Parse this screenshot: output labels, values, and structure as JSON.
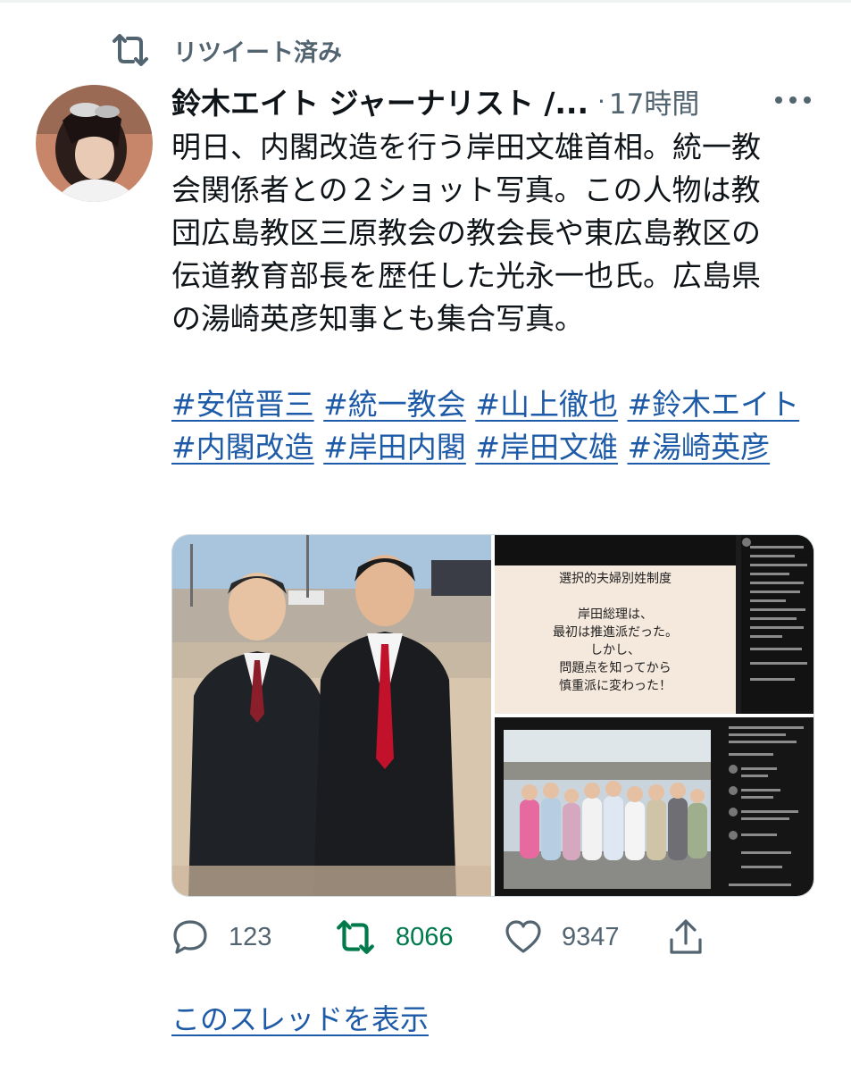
{
  "retweet_context": {
    "label": "リツイート済み",
    "icon": "retweet-icon"
  },
  "tweet": {
    "author_name": "鈴木エイト ジャーナリスト /...",
    "time_separator": "·",
    "timestamp": "17時間",
    "more_icon": "more-dots-icon",
    "avatar_icon": "avatar-photo",
    "body_lines": [
      "明日、内閣改造を行う岸田文雄首相。統一教",
      "会関係者との２ショット写真。この人物は教",
      "団広島教区三原教会の教会長や東広島教区の",
      "伝道教育部長を歴任した光永一也氏。広島県",
      "の湯崎英彦知事とも集合写真。"
    ],
    "hashtags": [
      "#安倍晋三",
      "#統一教会",
      "#山上徹也",
      "#鈴木エイト",
      "#内閣改造",
      "#岸田内閣",
      "#岸田文雄",
      "#湯崎英彦"
    ]
  },
  "media": {
    "slide_text": [
      "選択的夫婦別姓制度",
      "",
      "岸田総理は、",
      "最初は推進派だった。",
      "しかし、",
      "問題点を知ってから",
      "慎重派に変わった！"
    ]
  },
  "actions": {
    "reply": {
      "icon": "reply-icon",
      "count": "123"
    },
    "retweet": {
      "icon": "retweet-icon",
      "count": "8066",
      "color": "#00794b"
    },
    "like": {
      "icon": "heart-icon",
      "count": "9347"
    },
    "share": {
      "icon": "share-icon"
    }
  },
  "show_thread": "このスレッドを表示",
  "colors": {
    "link": "#1d5aa7",
    "secondary_text": "#536471",
    "retweet_active": "#00794b",
    "primary_text": "#0f1419"
  }
}
